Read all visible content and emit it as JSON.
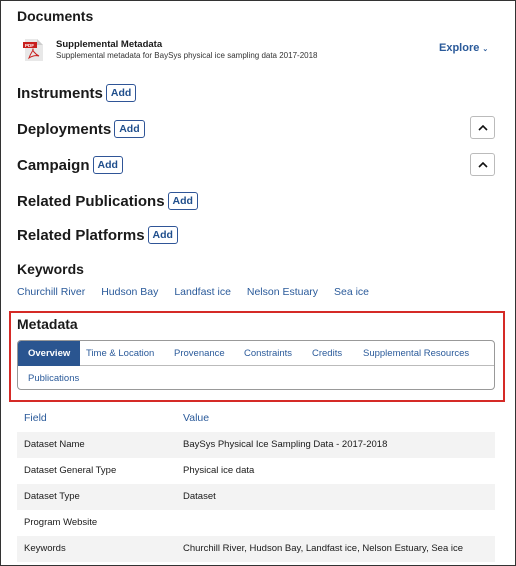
{
  "documents": {
    "heading": "Documents",
    "item": {
      "title": "Supplemental Metadata",
      "description": "Supplemental metadata for BaySys physical ice sampling data 2017-2018",
      "pdf_label": "PDF",
      "explore_label": "Explore"
    }
  },
  "instruments": {
    "heading": "Instruments",
    "add_label": "Add"
  },
  "deployments": {
    "heading": "Deployments",
    "add_label": "Add"
  },
  "campaign": {
    "heading": "Campaign",
    "add_label": "Add"
  },
  "related_publications": {
    "heading": "Related Publications",
    "add_label": "Add"
  },
  "related_platforms": {
    "heading": "Related Platforms",
    "add_label": "Add"
  },
  "keywords": {
    "heading": "Keywords",
    "items": [
      "Churchill River",
      "Hudson Bay",
      "Landfast ice",
      "Nelson Estuary",
      "Sea ice"
    ]
  },
  "metadata": {
    "heading": "Metadata",
    "tabs": [
      "Overview",
      "Time & Location",
      "Provenance",
      "Constraints",
      "Credits",
      "Supplemental Resources",
      "Publications"
    ],
    "active_tab": "Overview"
  },
  "table": {
    "headers": [
      "Field",
      "Value"
    ],
    "rows": [
      [
        "Dataset Name",
        "BaySys Physical Ice Sampling Data - 2017-2018"
      ],
      [
        "Dataset General Type",
        "Physical ice data"
      ],
      [
        "Dataset Type",
        "Dataset"
      ],
      [
        "Program Website",
        ""
      ],
      [
        "Keywords",
        "Churchill River, Hudson Bay, Landfast ice, Nelson Estuary, Sea ice"
      ]
    ]
  },
  "colors": {
    "link": "#2a5a9a",
    "active_tab_bg": "#2a5590",
    "highlight_border": "#d52a26",
    "pdf_red": "#c8201e"
  }
}
